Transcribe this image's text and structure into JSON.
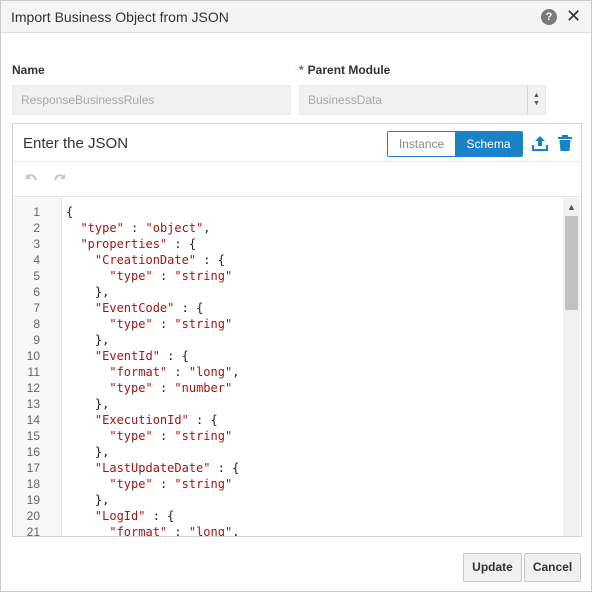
{
  "dialog": {
    "title": "Import Business Object from JSON"
  },
  "form": {
    "name_label": "Name",
    "name_value": "ResponseBusinessRules",
    "parent_required_marker": "*",
    "parent_label": "Parent Module",
    "parent_value": "BusinessData"
  },
  "editor": {
    "title": "Enter the JSON",
    "modes": [
      "Instance",
      "Schema"
    ],
    "active_mode": "Schema",
    "lines": [
      {
        "n": "1",
        "code": "{"
      },
      {
        "n": "2",
        "code": "  \"type\" : \"object\","
      },
      {
        "n": "3",
        "code": "  \"properties\" : {"
      },
      {
        "n": "4",
        "code": "    \"CreationDate\" : {"
      },
      {
        "n": "5",
        "code": "      \"type\" : \"string\""
      },
      {
        "n": "6",
        "code": "    },"
      },
      {
        "n": "7",
        "code": "    \"EventCode\" : {"
      },
      {
        "n": "8",
        "code": "      \"type\" : \"string\""
      },
      {
        "n": "9",
        "code": "    },"
      },
      {
        "n": "10",
        "code": "    \"EventId\" : {"
      },
      {
        "n": "11",
        "code": "      \"format\" : \"long\","
      },
      {
        "n": "12",
        "code": "      \"type\" : \"number\""
      },
      {
        "n": "13",
        "code": "    },"
      },
      {
        "n": "14",
        "code": "    \"ExecutionId\" : {"
      },
      {
        "n": "15",
        "code": "      \"type\" : \"string\""
      },
      {
        "n": "16",
        "code": "    },"
      },
      {
        "n": "17",
        "code": "    \"LastUpdateDate\" : {"
      },
      {
        "n": "18",
        "code": "      \"type\" : \"string\""
      },
      {
        "n": "19",
        "code": "    },"
      },
      {
        "n": "20",
        "code": "    \"LogId\" : {"
      },
      {
        "n": "21",
        "code": "      \"format\" : \"long\","
      }
    ]
  },
  "footer": {
    "update_label": "Update",
    "cancel_label": "Cancel"
  },
  "icons": {
    "help": "help-icon",
    "close": "close-icon",
    "upload": "upload-icon",
    "trash": "trash-icon",
    "undo": "undo-icon",
    "redo": "redo-icon"
  },
  "colors": {
    "accent": "#1a83c6",
    "string": "#a31515"
  }
}
